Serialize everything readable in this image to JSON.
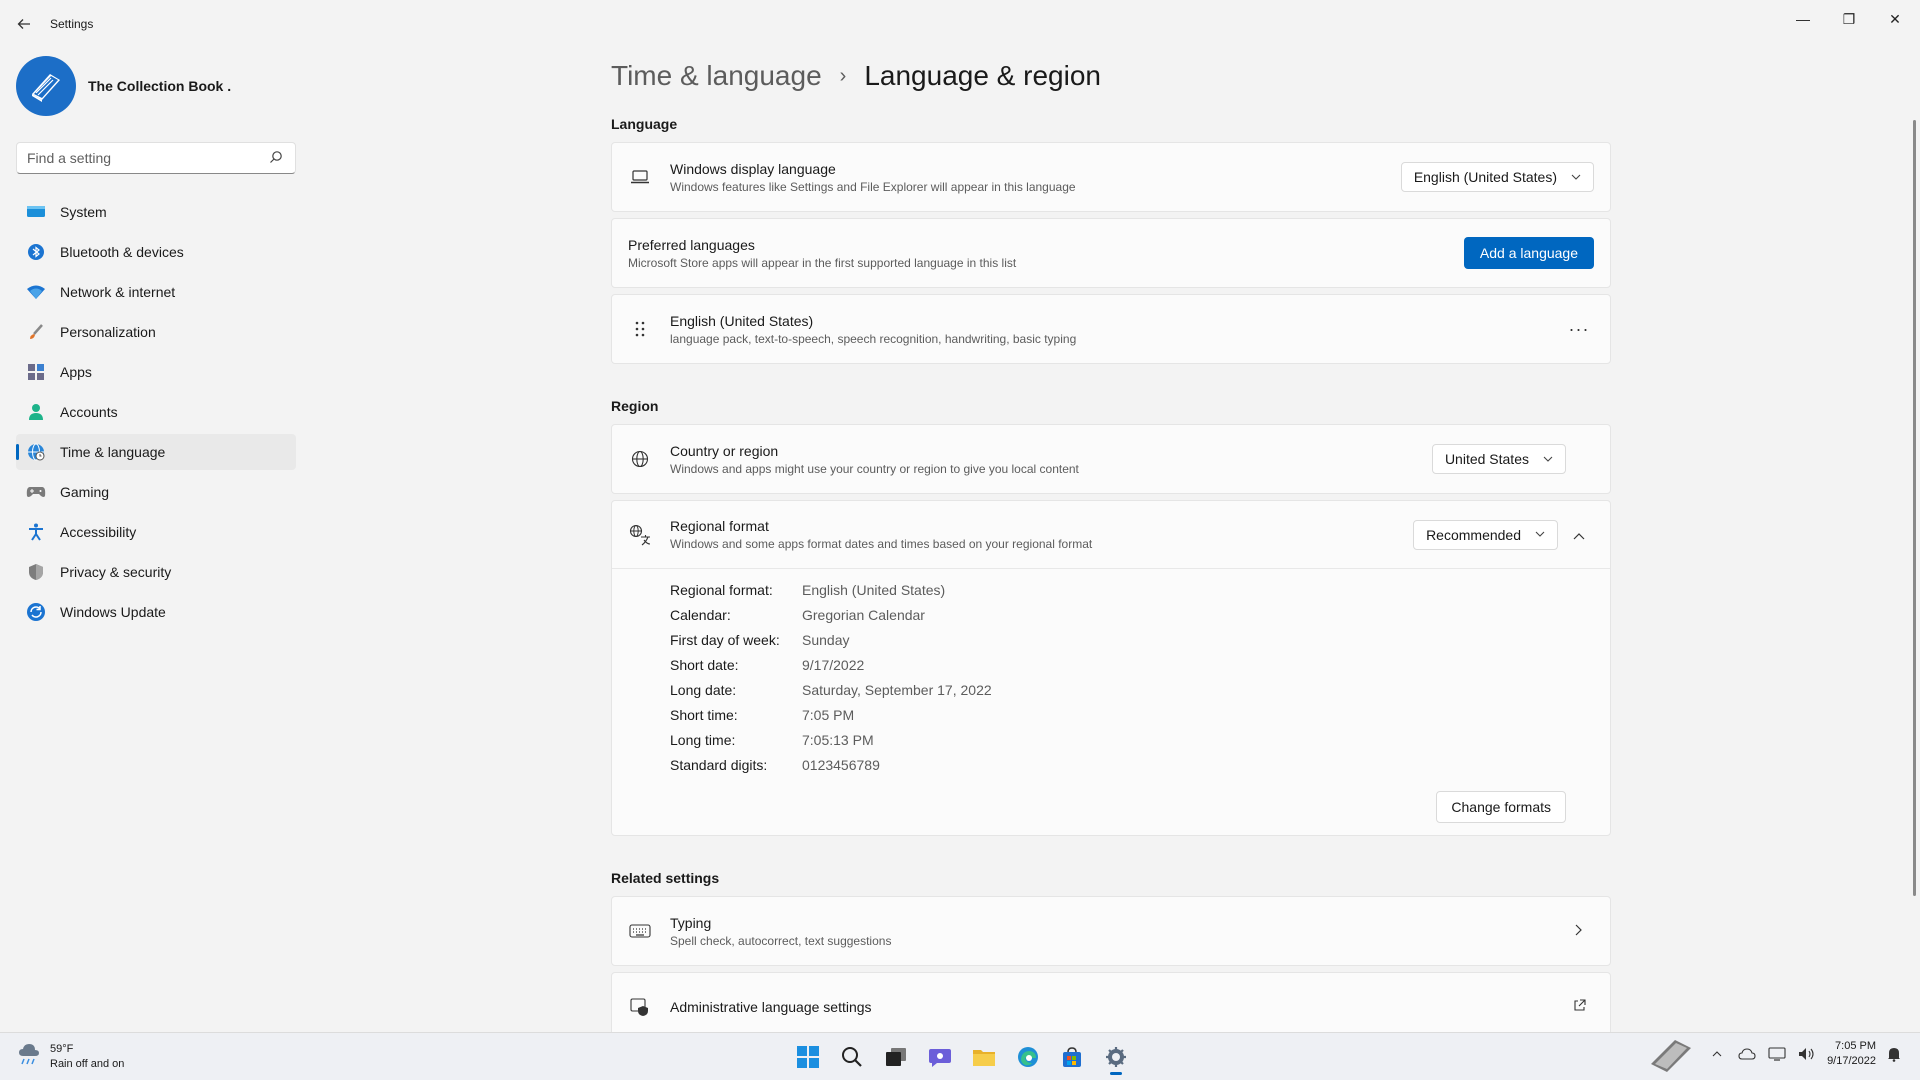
{
  "window": {
    "title": "Settings",
    "minimize_glyph": "—",
    "restore_glyph": "❐",
    "close_glyph": "✕"
  },
  "sidebar": {
    "profile_name": "The Collection Book .",
    "search_placeholder": "Find a setting",
    "items": [
      {
        "label": "System",
        "icon": "monitor-icon"
      },
      {
        "label": "Bluetooth & devices",
        "icon": "bluetooth-icon"
      },
      {
        "label": "Network & internet",
        "icon": "wifi-icon"
      },
      {
        "label": "Personalization",
        "icon": "brush-icon"
      },
      {
        "label": "Apps",
        "icon": "apps-icon"
      },
      {
        "label": "Accounts",
        "icon": "person-icon"
      },
      {
        "label": "Time & language",
        "icon": "globe-clock-icon",
        "active": true
      },
      {
        "label": "Gaming",
        "icon": "gamepad-icon"
      },
      {
        "label": "Accessibility",
        "icon": "accessibility-icon"
      },
      {
        "label": "Privacy & security",
        "icon": "shield-icon"
      },
      {
        "label": "Windows Update",
        "icon": "update-icon"
      }
    ]
  },
  "main": {
    "breadcrumb_parent": "Time & language",
    "breadcrumb_sep": "›",
    "breadcrumb_current": "Language & region",
    "language_section": "Language",
    "display_language": {
      "title": "Windows display language",
      "desc": "Windows features like Settings and File Explorer will appear in this language",
      "value": "English (United States)"
    },
    "preferred": {
      "title": "Preferred languages",
      "desc": "Microsoft Store apps will appear in the first supported language in this list",
      "button": "Add a language"
    },
    "english_us": {
      "title": "English (United States)",
      "desc": "language pack, text-to-speech, speech recognition, handwriting, basic typing",
      "more": "···"
    },
    "region_section": "Region",
    "country": {
      "title": "Country or region",
      "desc": "Windows and apps might use your country or region to give you local content",
      "value": "United States"
    },
    "regional_format": {
      "title": "Regional format",
      "desc": "Windows and some apps format dates and times based on your regional format",
      "value": "Recommended",
      "details": [
        {
          "label": "Regional format:",
          "value": "English (United States)"
        },
        {
          "label": "Calendar:",
          "value": "Gregorian Calendar"
        },
        {
          "label": "First day of week:",
          "value": "Sunday"
        },
        {
          "label": "Short date:",
          "value": "9/17/2022"
        },
        {
          "label": "Long date:",
          "value": "Saturday, September 17, 2022"
        },
        {
          "label": "Short time:",
          "value": "7:05 PM"
        },
        {
          "label": "Long time:",
          "value": "7:05:13 PM"
        },
        {
          "label": "Standard digits:",
          "value": "0123456789"
        }
      ],
      "change_button": "Change formats"
    },
    "related_section": "Related settings",
    "typing": {
      "title": "Typing",
      "desc": "Spell check, autocorrect, text suggestions"
    },
    "admin": {
      "title": "Administrative language settings"
    }
  },
  "taskbar": {
    "weather_temp": "59°F",
    "weather_desc": "Rain off and on",
    "time": "7:05 PM",
    "date": "9/17/2022",
    "apps": [
      "start-icon",
      "search-icon",
      "task-view-icon",
      "chat-icon",
      "file-explorer-icon",
      "edge-icon",
      "store-icon",
      "settings-icon"
    ]
  },
  "colors": {
    "accent": "#0067c0",
    "background": "#f3f3f3",
    "card": "#fbfbfb"
  }
}
